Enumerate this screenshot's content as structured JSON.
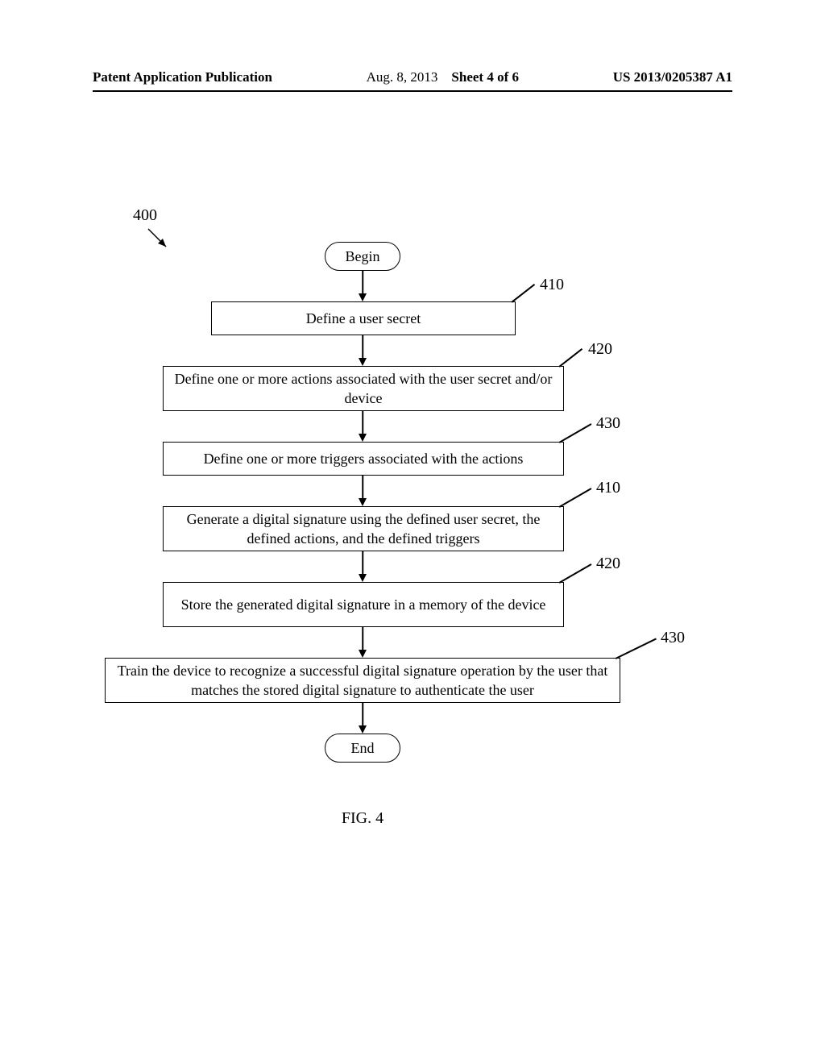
{
  "header": {
    "left": "Patent Application Publication",
    "date": "Aug. 8, 2013",
    "sheet": "Sheet 4 of 6",
    "pubno": "US 2013/0205387 A1"
  },
  "flow": {
    "ref400": "400",
    "begin": "Begin",
    "step1": {
      "ref": "410",
      "text": "Define a user secret"
    },
    "step2": {
      "ref": "420",
      "text": "Define one or more actions associated with the user secret and/or device"
    },
    "step3": {
      "ref": "430",
      "text": "Define one or more triggers associated with the actions"
    },
    "step4": {
      "ref": "410",
      "text": "Generate a digital signature using the defined user secret, the defined actions, and the defined triggers"
    },
    "step5": {
      "ref": "420",
      "text": "Store the generated digital signature in a memory of the device"
    },
    "step6": {
      "ref": "430",
      "text": "Train the device to recognize a successful digital signature operation by the user that matches the stored digital signature to authenticate the user"
    },
    "end": "End"
  },
  "caption": "FIG. 4"
}
